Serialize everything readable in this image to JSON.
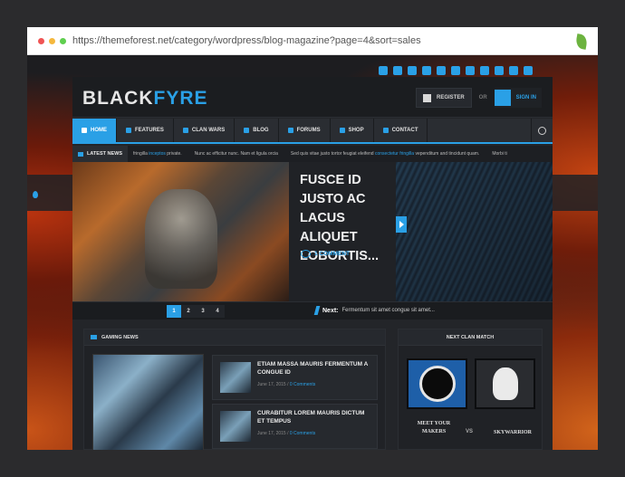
{
  "browser": {
    "url": "https://themeforest.net/category/wordpress/blog-magazine?page=4&sort=sales",
    "dots": [
      "#f05454",
      "#f5b83d",
      "#5fcf4f"
    ]
  },
  "colors": {
    "accent": "#2aa0e6",
    "background": "#1c1e21"
  },
  "social_icons": [
    "rss-icon",
    "at-icon",
    "vimeo-icon",
    "youtube-icon",
    "twitch-icon",
    "instagram-icon",
    "steam-icon",
    "pinterest-icon",
    "google-plus-icon",
    "vk-icon",
    "twitter-icon"
  ],
  "logo": {
    "part1": "BLACK",
    "part2": "FYRE"
  },
  "auth": {
    "register": "REGISTER",
    "or": "OR",
    "signin": "SIGN IN"
  },
  "nav": {
    "items": [
      {
        "label": "HOME",
        "icon": "home-icon"
      },
      {
        "label": "FEATURES",
        "icon": "star-icon"
      },
      {
        "label": "CLAN WARS",
        "icon": "eye-icon"
      },
      {
        "label": "BLOG",
        "icon": "rss-icon"
      },
      {
        "label": "FORUMS",
        "icon": "users-icon"
      },
      {
        "label": "SHOP",
        "icon": "cart-icon"
      },
      {
        "label": "CONTACT",
        "icon": "list-icon"
      }
    ],
    "search_icon": "search-icon"
  },
  "ticker": {
    "label": "LATEST NEWS",
    "items": [
      {
        "text": "fringilla ",
        "link": "inceptos",
        "tail": " private."
      },
      {
        "text": "Nunc ac efficitur nunc. Nam et ligula orcia",
        "link": "",
        "tail": ""
      },
      {
        "text": "Sed quis vitae justo tortor feugiat eleifend ",
        "link": "consectetur fringilla",
        "tail": " vependitum and tincidunt quam."
      },
      {
        "text": "Morbi ti",
        "link": "",
        "tail": ""
      }
    ]
  },
  "slider": {
    "headline": "FUSCE ID JUSTO AC LACUS ALIQUET LOBORTIS...",
    "comments": "1 COMMENT",
    "pages": [
      "1",
      "2",
      "3",
      "4"
    ],
    "active_page": "1",
    "next_label": "Next:",
    "next_text": "Fermentum sit amet congue sit amet..."
  },
  "gaming": {
    "title": "GAMING NEWS",
    "articles": [
      {
        "title": "ETIAM MASSA MAURIS FERMENTUM A CONGUE ID",
        "date": "June 17, 2015",
        "comments": "0 Comments"
      },
      {
        "title": "CURABITUR LOREM MAURIS DICTUM ET TEMPUS",
        "date": "June 17, 2015",
        "comments": "0 Comments"
      }
    ]
  },
  "clan": {
    "title": "NEXT CLAN MATCH",
    "team_a": "MEET YOUR MAKERS",
    "vs": "VS",
    "team_b": "SKYWARRIOR"
  }
}
